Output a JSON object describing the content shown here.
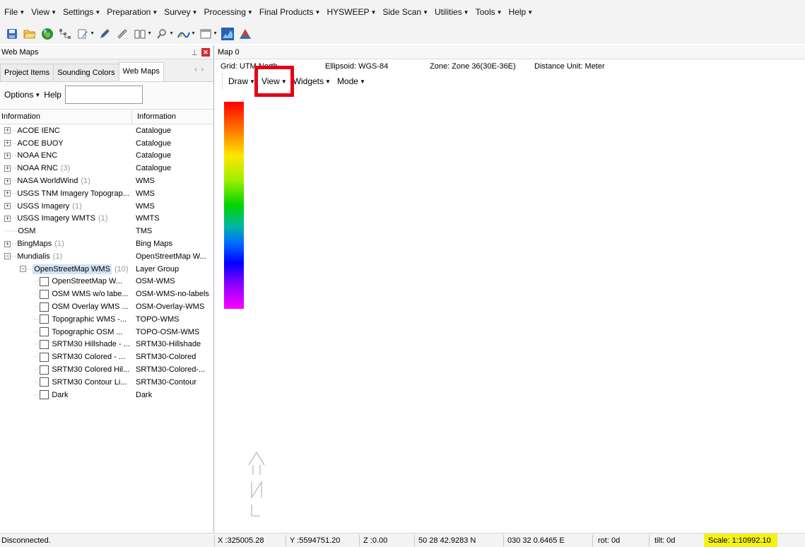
{
  "menubar": {
    "items": [
      "File",
      "View",
      "Settings",
      "Preparation",
      "Survey",
      "Processing",
      "Final Products",
      "HYSWEEP",
      "Side Scan",
      "Utilities",
      "Tools",
      "Help"
    ]
  },
  "toolbar": {
    "icons": [
      "save-icon",
      "open-folder-icon",
      "globe-icon",
      "network-icon",
      "edit-icon",
      "pencil-icon",
      "ruler-icon",
      "book-icon",
      "magnifier-icon",
      "chart-icon",
      "window-icon",
      "blue-chart-icon",
      "mountain-icon"
    ]
  },
  "left_panel": {
    "title": "Web Maps",
    "tabs": [
      "Project Items",
      "Sounding Colors",
      "Web Maps"
    ],
    "active_tab": "Web Maps",
    "options_label": "Options",
    "help_label": "Help",
    "search_value": "",
    "columns": [
      "Information",
      "Information"
    ],
    "rows": [
      {
        "name": "ACOE IENC",
        "count": "",
        "info": "Catalogue",
        "type": "expandable"
      },
      {
        "name": "ACOE BUOY",
        "count": "",
        "info": "Catalogue",
        "type": "expandable"
      },
      {
        "name": "NOAA ENC",
        "count": "",
        "info": "Catalogue",
        "type": "expandable"
      },
      {
        "name": "NOAA RNC",
        "count": "(3)",
        "info": "Catalogue",
        "type": "expandable"
      },
      {
        "name": "NASA WorldWind",
        "count": "(1)",
        "info": "WMS",
        "type": "expandable"
      },
      {
        "name": "USGS TNM Imagery Topograp...",
        "count": "",
        "info": "WMS",
        "type": "expandable"
      },
      {
        "name": "USGS Imagery",
        "count": "(1)",
        "info": "WMS",
        "type": "expandable"
      },
      {
        "name": "USGS Imagery WMTS",
        "count": "(1)",
        "info": "WMTS",
        "type": "expandable"
      },
      {
        "name": "OSM",
        "count": "",
        "info": "TMS",
        "type": "leaf"
      },
      {
        "name": "BingMaps",
        "count": "(1)",
        "info": "Bing Maps",
        "type": "expandable"
      },
      {
        "name": "Mundialis",
        "count": "(1)",
        "info": "OpenStreetMap W...",
        "type": "expanded"
      },
      {
        "name": "OpenStreetMap WMS",
        "count": "(10)",
        "info": "Layer Group",
        "type": "group"
      },
      {
        "name": "OpenStreetMap W...",
        "count": "",
        "info": "OSM-WMS",
        "type": "layer"
      },
      {
        "name": "OSM WMS w/o labe...",
        "count": "",
        "info": "OSM-WMS-no-labels",
        "type": "layer"
      },
      {
        "name": "OSM Overlay WMS ...",
        "count": "",
        "info": "OSM-Overlay-WMS",
        "type": "layer"
      },
      {
        "name": "Topographic WMS -...",
        "count": "",
        "info": "TOPO-WMS",
        "type": "layer"
      },
      {
        "name": "Topographic OSM ...",
        "count": "",
        "info": "TOPO-OSM-WMS",
        "type": "layer"
      },
      {
        "name": "SRTM30 Hillshade - ...",
        "count": "",
        "info": "SRTM30-Hillshade",
        "type": "layer"
      },
      {
        "name": "SRTM30 Colored - ...",
        "count": "",
        "info": "SRTM30-Colored",
        "type": "layer"
      },
      {
        "name": "SRTM30 Colored Hil...",
        "count": "",
        "info": "SRTM30-Colored-...",
        "type": "layer"
      },
      {
        "name": "SRTM30 Contour Li...",
        "count": "",
        "info": "SRTM30-Contour",
        "type": "layer"
      },
      {
        "name": "Dark",
        "count": "",
        "info": "Dark",
        "type": "layer"
      }
    ]
  },
  "map": {
    "tab_title": "Map 0",
    "grid_label": "Grid: UTM",
    "grid_hidden": "North",
    "ellipsoid": "Ellipsoid: WGS-84",
    "zone": "Zone: Zone 36(30E-36E)",
    "distance_unit": "Distance Unit: Meter",
    "menus": [
      "Draw",
      "View",
      "Widgets",
      "Mode"
    ],
    "highlighted_menu": "View",
    "highlight_color": "#e3001b",
    "north_label": "N"
  },
  "statusbar": {
    "connection": "Disconnected.",
    "x": "X :325005.28",
    "y": "Y :5594751.20",
    "z": "Z :0.00",
    "lat": "50 28 42.9283 N",
    "lon": "030 32 0.6465 E",
    "rot": "rot:  0d",
    "tilt": "tilt:  0d",
    "scale": "Scale: 1:10992.10",
    "scale_highlight_color": "#f5f11a"
  }
}
